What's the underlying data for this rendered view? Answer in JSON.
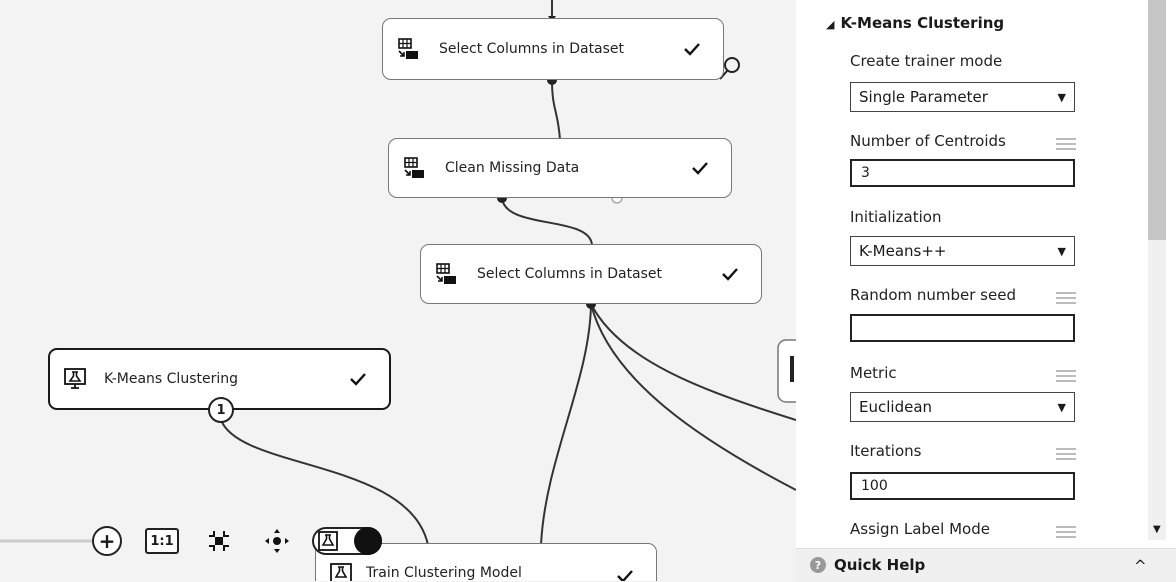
{
  "canvas": {
    "modules": [
      {
        "id": "select1",
        "label": "Select Columns in Dataset",
        "icon": "table-transform-icon",
        "status": "check"
      },
      {
        "id": "clean",
        "label": "Clean Missing Data",
        "icon": "table-transform-icon",
        "status": "check"
      },
      {
        "id": "select2",
        "label": "Select Columns in Dataset",
        "icon": "table-transform-icon",
        "status": "check"
      },
      {
        "id": "kmeans",
        "label": "K-Means Clustering",
        "icon": "monitor-flask-icon",
        "status": "check"
      },
      {
        "id": "train",
        "label": "Train Clustering Model",
        "icon": "flask-icon",
        "status": "check"
      }
    ],
    "kmeans_port_badge": "1",
    "toolbar": {
      "zoom_in_label": "+",
      "actual_size_label": "1:1",
      "icons": [
        "zoom-in-icon",
        "actual-size-icon",
        "fit-to-screen-icon",
        "pan-icon",
        "experiment-toggle-icon"
      ]
    }
  },
  "properties": {
    "section_title": "K-Means Clustering",
    "section_toggle": "◢",
    "fields": {
      "trainer_mode": {
        "label": "Create trainer mode",
        "value": "Single Parameter"
      },
      "centroids": {
        "label": "Number of Centroids",
        "value": "3"
      },
      "initialization": {
        "label": "Initialization",
        "value": "K-Means++"
      },
      "seed": {
        "label": "Random number seed",
        "value": ""
      },
      "metric": {
        "label": "Metric",
        "value": "Euclidean"
      },
      "iterations": {
        "label": "Iterations",
        "value": "100"
      },
      "assign_label": {
        "label": "Assign Label Mode"
      }
    },
    "select_arrow": "▼",
    "scroll_down": "▼"
  },
  "quick_help": {
    "label": "Quick Help",
    "chevron": "^"
  },
  "colors": {
    "canvas_bg": "#f3f3f3",
    "panel_bg": "#ffffff",
    "border": "#222222"
  }
}
